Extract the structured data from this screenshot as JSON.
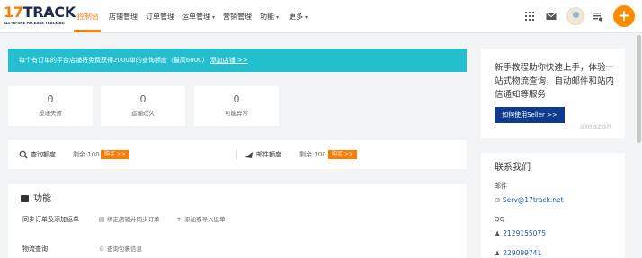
{
  "logo": {
    "brand_a": "17",
    "brand_b": "TRACK",
    "tagline": "ALL-IN-ONE PACKAGE TRACKING"
  },
  "nav": {
    "items": [
      {
        "label": "控制台",
        "active": true
      },
      {
        "label": "店铺管理"
      },
      {
        "label": "订单管理"
      },
      {
        "label": "运单管理",
        "dropdown": true
      },
      {
        "label": "营销管理"
      },
      {
        "label": "功能",
        "dropdown": true
      },
      {
        "label": "更多",
        "dropdown": true
      }
    ],
    "caret": "▾",
    "fab_label": "+",
    "accent": "#ff7a00",
    "icons": [
      "apps-grid-icon",
      "mail-icon",
      "avatar",
      "task-list-icon",
      "add-icon"
    ]
  },
  "notice": {
    "text": "每个有订单的平台店铺将免费获得2000单的查询额度（最高6000）",
    "link": "添加店铺 >>",
    "color": "#23bfcf"
  },
  "stats": [
    {
      "value": "0",
      "label": "投递失败"
    },
    {
      "value": "0",
      "label": "运输过久"
    },
    {
      "value": "0",
      "label": "可能异常"
    }
  ],
  "quota": {
    "query": {
      "label": "查询额度",
      "remaining": "剩余:100",
      "buy": "购买 >>"
    },
    "email": {
      "label": "邮件额度",
      "remaining": "剩余:100",
      "buy": "购买 >>"
    }
  },
  "functions": {
    "title": "功能",
    "rows": [
      {
        "label": "同步订单及添加运单",
        "actions": [
          {
            "icon": "store-icon",
            "glyph": "▤",
            "label": "绑定店铺并同步订单"
          },
          {
            "icon": "plus-icon",
            "glyph": "+",
            "label": "添加或导入运单"
          }
        ]
      },
      {
        "label": "物流查询",
        "actions": [
          {
            "icon": "search-icon",
            "glyph": "⊙",
            "label": "查询包裹信息"
          }
        ]
      }
    ]
  },
  "guide": {
    "text": "新手教程助你快速上手，体验一站式物流查询，自动邮件和站内信通知等服务",
    "button": "如何使用Seller >>",
    "watermark": "amazon"
  },
  "contact": {
    "title": "联系我们",
    "email_label": "邮件",
    "email": "Serv@17track.net",
    "qq_label": "QQ",
    "qq_numbers": [
      "2129155075",
      "229099741"
    ]
  }
}
